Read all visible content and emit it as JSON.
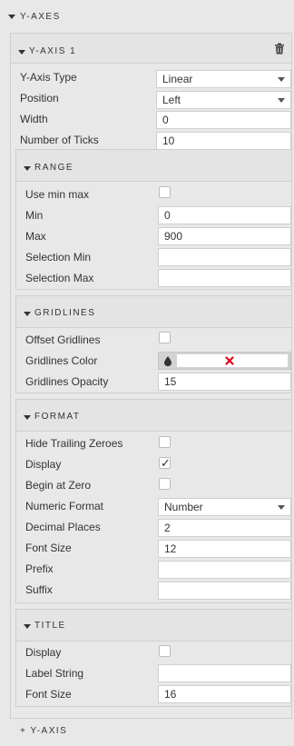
{
  "y_axes": {
    "title": "Y-AXES",
    "add_label": "+ Y-AXIS"
  },
  "y_axis_1": {
    "title": "Y-AXIS 1",
    "type_label": "Y-Axis Type",
    "type_value": "Linear",
    "position_label": "Position",
    "position_value": "Left",
    "width_label": "Width",
    "width_value": "0",
    "ticks_label": "Number of Ticks",
    "ticks_value": "10"
  },
  "range": {
    "title": "RANGE",
    "use_min_max_label": "Use min max",
    "use_min_max_checked": false,
    "min_label": "Min",
    "min_value": "0",
    "max_label": "Max",
    "max_value": "900",
    "sel_min_label": "Selection Min",
    "sel_min_value": "",
    "sel_max_label": "Selection Max",
    "sel_max_value": ""
  },
  "gridlines": {
    "title": "GRIDLINES",
    "offset_label": "Offset Gridlines",
    "offset_checked": false,
    "color_label": "Gridlines Color",
    "opacity_label": "Gridlines Opacity",
    "opacity_value": "15"
  },
  "format": {
    "title": "FORMAT",
    "hide_zeroes_label": "Hide Trailing Zeroes",
    "hide_zeroes_checked": false,
    "display_label": "Display",
    "display_checked": true,
    "begin_zero_label": "Begin at Zero",
    "begin_zero_checked": false,
    "numeric_label": "Numeric Format",
    "numeric_value": "Number",
    "decimals_label": "Decimal Places",
    "decimals_value": "2",
    "font_size_label": "Font Size",
    "font_size_value": "12",
    "prefix_label": "Prefix",
    "prefix_value": "",
    "suffix_label": "Suffix",
    "suffix_value": ""
  },
  "title_section": {
    "title": "TITLE",
    "display_label": "Display",
    "display_checked": false,
    "label_string_label": "Label String",
    "label_string_value": "",
    "font_size_label": "Font Size",
    "font_size_value": "16"
  },
  "icons": {
    "trash": "trash-icon",
    "dropper": "color-dropper-icon",
    "clear": "clear-color-icon",
    "caret": "chevron-down-icon",
    "collapse": "collapse-triangle-icon",
    "check": "checkmark-icon"
  },
  "colors": {
    "panel_bg": "#e8e8e8",
    "border": "#cfcfcf",
    "clear_red": "#e0001b"
  }
}
